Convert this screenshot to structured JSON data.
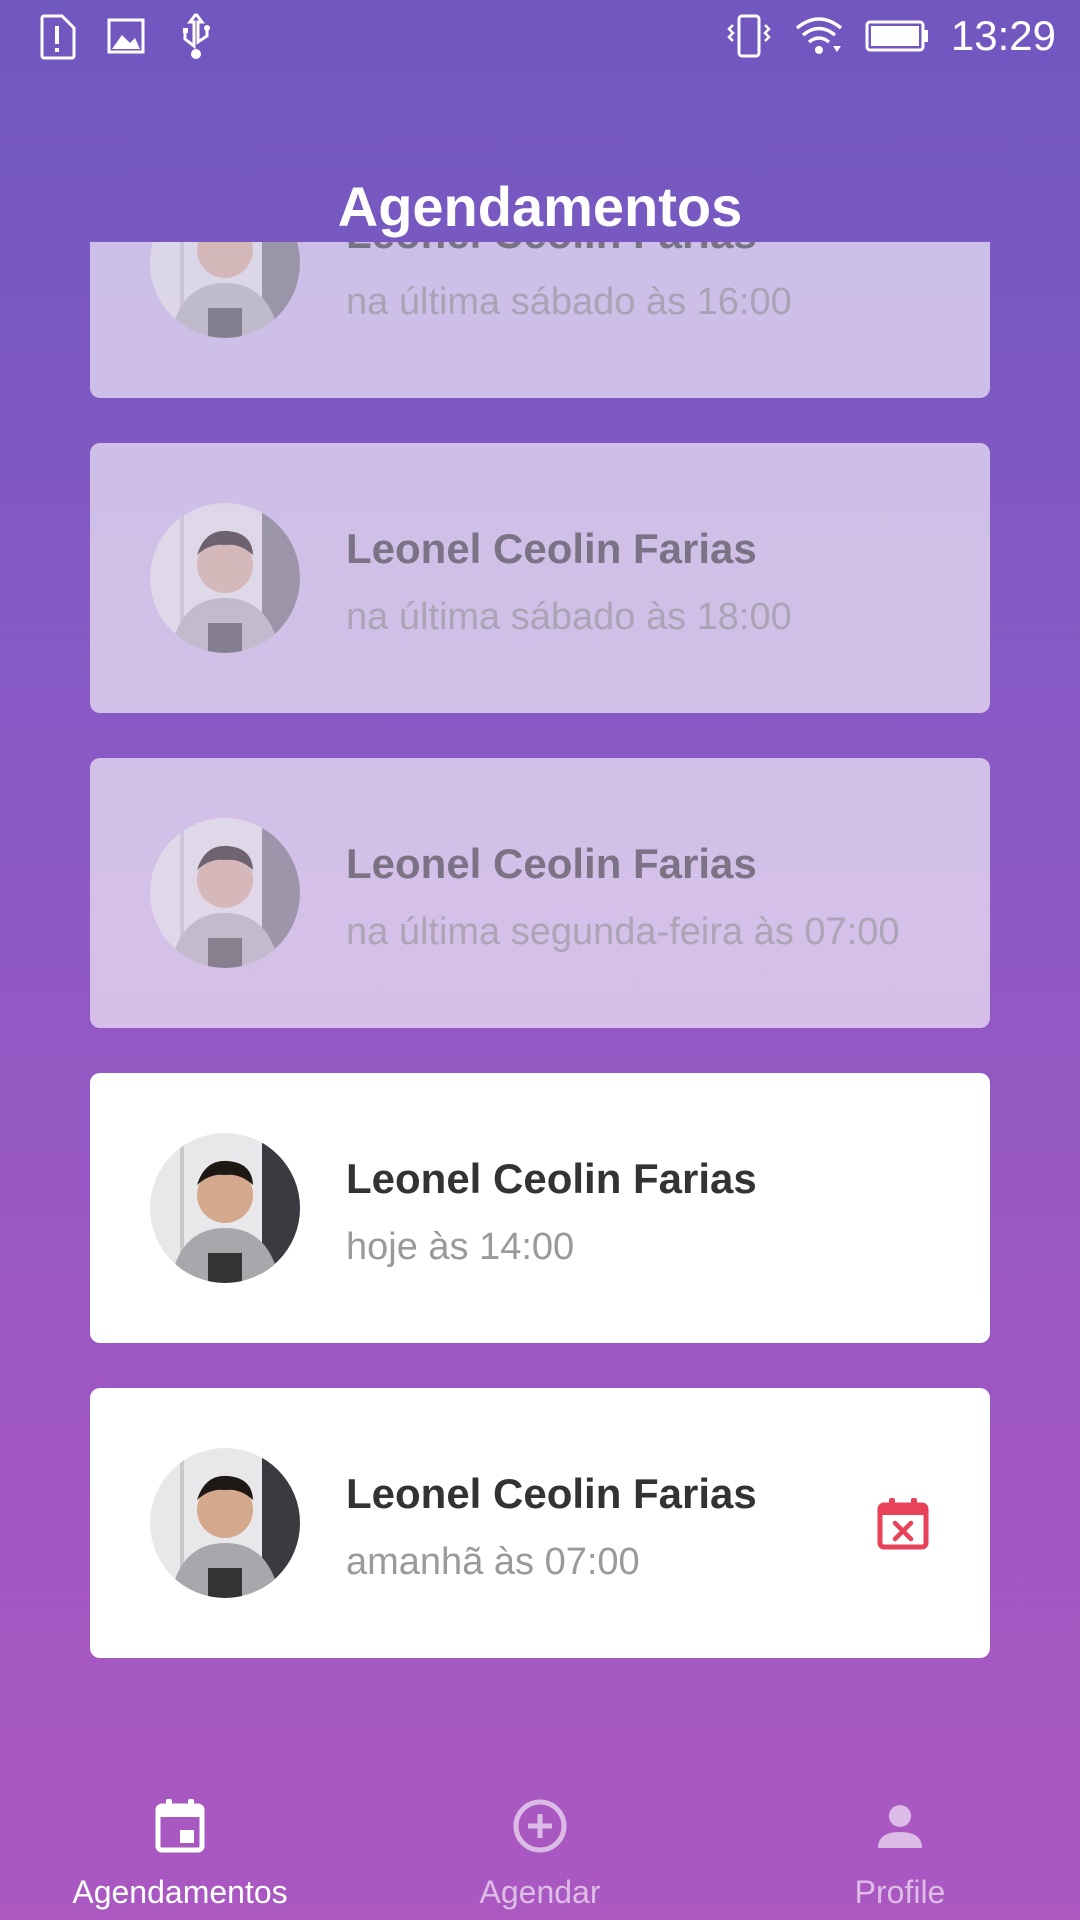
{
  "status_bar": {
    "time": "13:29",
    "left_icons": [
      "alert-sd-icon",
      "image-icon",
      "usb-icon"
    ],
    "right_icons": [
      "vibrate-icon",
      "wifi-icon",
      "battery-icon"
    ]
  },
  "header": {
    "title": "Agendamentos"
  },
  "appointments": [
    {
      "name": "Leonel Ceolin Farias",
      "when": "na última sábado às 16:00",
      "past": true
    },
    {
      "name": "Leonel Ceolin Farias",
      "when": "na última sábado às 18:00",
      "past": true
    },
    {
      "name": "Leonel Ceolin Farias",
      "when": "na última segunda-feira às 07:00",
      "past": true
    },
    {
      "name": "Leonel Ceolin Farias",
      "when": "hoje às 14:00",
      "past": false
    },
    {
      "name": "Leonel Ceolin Farias",
      "when": "amanhã às 07:00",
      "past": false,
      "cancel_icon": "calendar-cancel-icon"
    }
  ],
  "bottom_nav": {
    "items": [
      {
        "label": "Agendamentos",
        "icon": "calendar-icon",
        "active": true
      },
      {
        "label": "Agendar",
        "icon": "add-circle-icon",
        "active": false
      },
      {
        "label": "Profile",
        "icon": "person-icon",
        "active": false
      }
    ]
  },
  "colors": {
    "gradient_top": "#7157c0",
    "gradient_bottom": "#ab58c1",
    "cancel_icon": "#e8425a",
    "name_text": "#333333",
    "when_text": "#9a9a9a"
  }
}
